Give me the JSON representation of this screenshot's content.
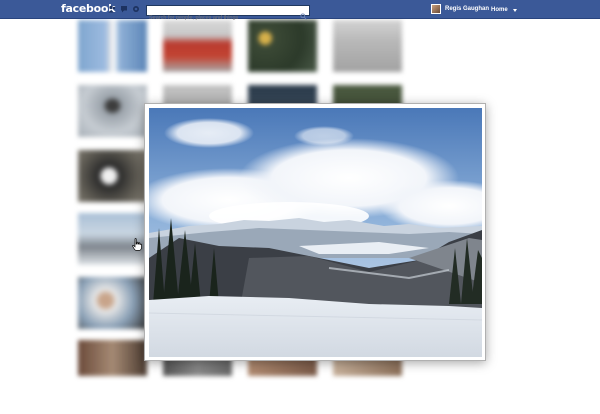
{
  "topbar": {
    "logo": "facebook",
    "search_placeholder": "Search for people, places and things",
    "user_name": "Regis Gaughan",
    "home_label": "Home"
  },
  "icons": {
    "friend_requests": "friends-icon",
    "messages": "messages-icon",
    "notifications": "notifications-icon",
    "search": "search-icon",
    "account": "chevron-down-icon",
    "cursor": "hand-pointer-icon"
  },
  "colors": {
    "topbar": "#3b5998",
    "topbar_border": "#29447e"
  },
  "photo": {
    "subject": "snowy-mountain-landscape"
  }
}
